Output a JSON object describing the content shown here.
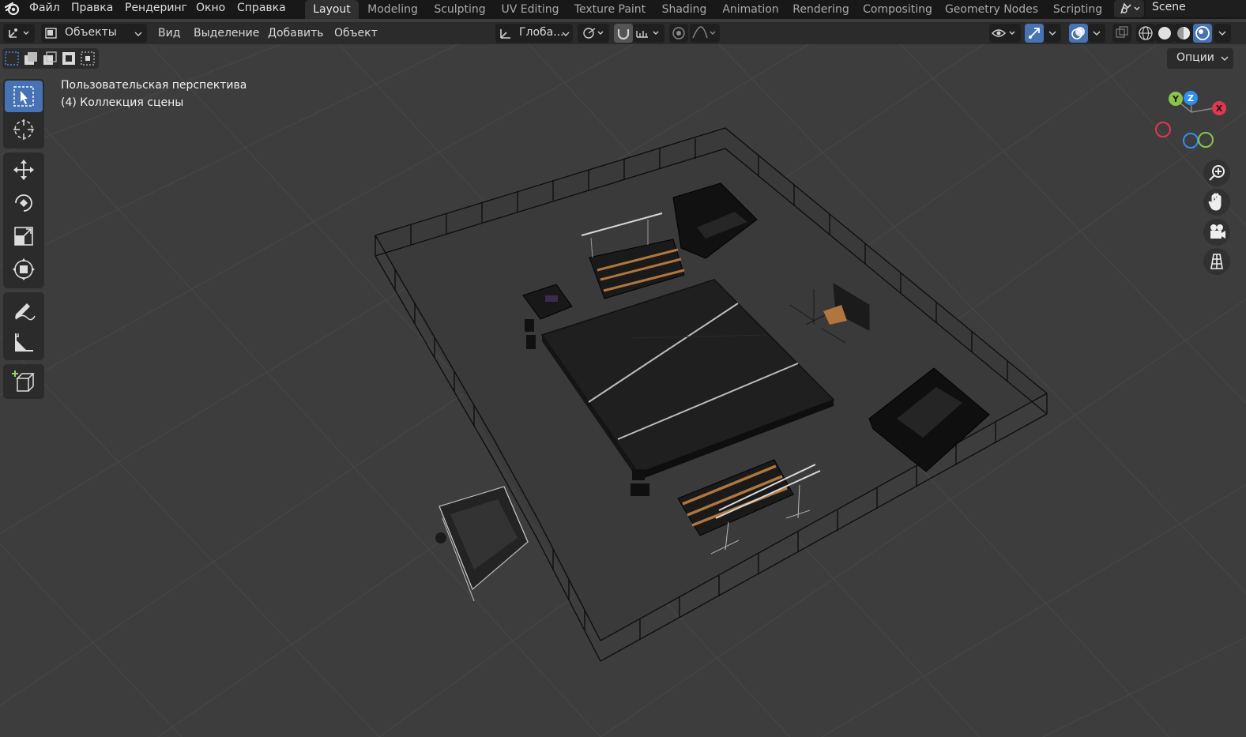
{
  "menu": {
    "file": "Файл",
    "edit": "Правка",
    "render": "Рендеринг",
    "window": "Окно",
    "help": "Справка"
  },
  "workspaces": [
    {
      "label": "Layout"
    },
    {
      "label": "Modeling"
    },
    {
      "label": "Sculpting"
    },
    {
      "label": "UV Editing"
    },
    {
      "label": "Texture Paint"
    },
    {
      "label": "Shading"
    },
    {
      "label": "Animation"
    },
    {
      "label": "Rendering"
    },
    {
      "label": "Compositing"
    },
    {
      "label": "Geometry Nodes"
    },
    {
      "label": "Scripting"
    }
  ],
  "active_workspace": "Layout",
  "scene": {
    "name": "Scene"
  },
  "header": {
    "mode": "Объекты",
    "view": "Вид",
    "select": "Выделение",
    "add": "Добавить",
    "object": "Объект",
    "orientation": "Глоба...",
    "options": "Опции"
  },
  "viewport": {
    "perspective": "Пользовательская перспектива",
    "collection": "(4) Коллекция сцены"
  },
  "tools": [
    {
      "icon": "select-box-icon",
      "active": true
    },
    {
      "icon": "cursor-icon",
      "active": false
    },
    {
      "icon": "move-icon",
      "active": false
    },
    {
      "icon": "rotate-icon",
      "active": false
    },
    {
      "icon": "scale-icon",
      "active": false
    },
    {
      "icon": "transform-icon",
      "active": false
    },
    {
      "icon": "annotate-icon",
      "active": false
    },
    {
      "icon": "measure-icon",
      "active": false
    },
    {
      "icon": "add-cube-icon",
      "active": false
    }
  ],
  "gizmo": {
    "x": "X",
    "y": "Y",
    "z": "Z"
  },
  "colors": {
    "accent": "#4772b3",
    "axis_x": "#e1374f",
    "axis_y": "#8bc34a",
    "axis_z": "#2f8ff5",
    "background": "#3d3d3d",
    "panel": "#2b2b2b"
  }
}
